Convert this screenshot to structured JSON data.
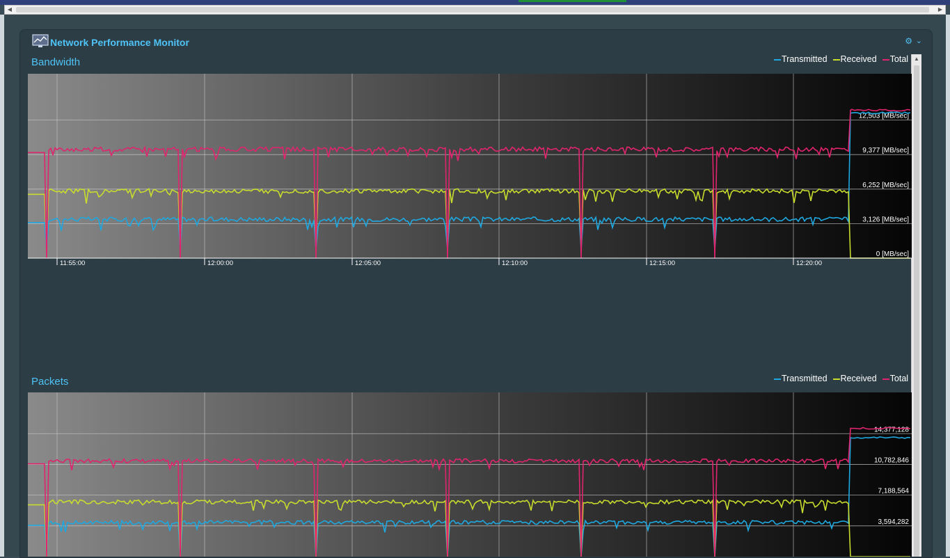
{
  "widget": {
    "title": "Network Performance Monitor"
  },
  "colors": {
    "transmitted": "#1fa8e0",
    "received": "#c8dc2e",
    "total": "#e0246e",
    "accent": "#4fc3f7"
  },
  "icons": {
    "widget": "chart-monitor-icon",
    "settings": "gear-icon",
    "collapse": "chevron-down-icon"
  },
  "chart_data": [
    {
      "type": "line",
      "title": "Bandwidth",
      "unit": "MB/sec",
      "legend": [
        "Transmitted",
        "Received",
        "Total"
      ],
      "legend_position": "top-right",
      "x_ticks": [
        "11:55:00",
        "12:00:00",
        "12:05:00",
        "12:10:00",
        "12:15:00",
        "12:20:00"
      ],
      "y_ticks": [
        0,
        3126,
        6252,
        9377,
        12503
      ],
      "y_tick_labels": [
        "0 [MB/sec]",
        "3,126 [MB/sec]",
        "6,252 [MB/sec]",
        "9,377 [MB/sec]",
        "12,503 [MB/sec]"
      ],
      "ylim": [
        0,
        16700
      ],
      "grid": true,
      "series": [
        {
          "name": "Transmitted",
          "color": "#1fa8e0",
          "baseline": 3520,
          "end_value": 13150,
          "dip_to": 800
        },
        {
          "name": "Received",
          "color": "#c8dc2e",
          "baseline": 6080,
          "end_value": 0,
          "dip_to": 900
        },
        {
          "name": "Total",
          "color": "#e0246e",
          "baseline": 9860,
          "end_value": 13400,
          "dip_to": 0
        }
      ]
    },
    {
      "type": "line",
      "title": "Packets",
      "unit": "",
      "legend": [
        "Transmitted",
        "Received",
        "Total"
      ],
      "legend_position": "top-right",
      "x_ticks": [
        "11:55:00",
        "12:00:00",
        "12:05:00",
        "12:10:00",
        "12:15:00",
        "12:20:00"
      ],
      "y_ticks": [
        3594282,
        7188564,
        10782846,
        14377128
      ],
      "y_tick_labels": [
        "3,594,282",
        "7,188,564",
        "10,782,846",
        "14,377,128"
      ],
      "ylim": [
        0,
        19200000
      ],
      "grid": true,
      "series": [
        {
          "name": "Transmitted",
          "color": "#1fa8e0",
          "baseline": 4000000,
          "end_value": 13900000,
          "dip_to": 0
        },
        {
          "name": "Received",
          "color": "#c8dc2e",
          "baseline": 6400000,
          "end_value": 0,
          "dip_to": 0
        },
        {
          "name": "Total",
          "color": "#e0246e",
          "baseline": 11200000,
          "end_value": 15000000,
          "dip_to": 0
        }
      ]
    }
  ]
}
